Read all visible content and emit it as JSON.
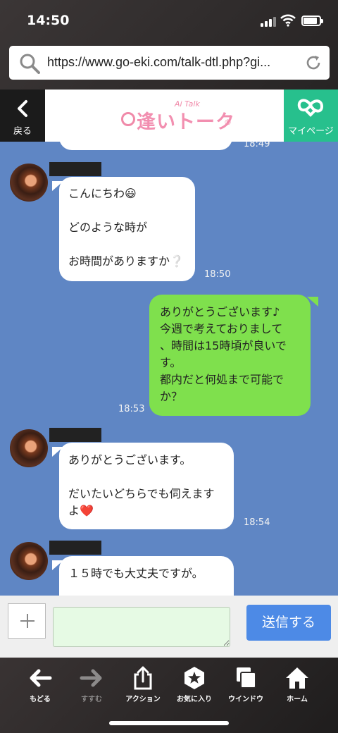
{
  "status_bar": {
    "time": "14:50"
  },
  "browser": {
    "url": "https://www.go-eki.com/talk-dtl.php?gi..."
  },
  "header": {
    "back_label": "戻る",
    "logo_main": "逢いトーク",
    "logo_sub": "Ai Talk",
    "logo_reg": "®",
    "mypage_label": "マイページ"
  },
  "chat": {
    "prev_time": "18:49",
    "messages": [
      {
        "side": "in",
        "lines": [
          "こんにちわ😃",
          "",
          "どのような時が",
          "",
          "お時間がありますか❔"
        ],
        "time": "18:50"
      },
      {
        "side": "out",
        "lines": [
          "ありがとうございます♪",
          "今週で考えておりまして",
          "、時間は15時頃が良いで",
          "す。",
          "都内だと何処まで可能で",
          "か？"
        ],
        "time": "18:53"
      },
      {
        "side": "in",
        "lines": [
          "ありがとうございます。",
          "",
          "だいたいどちらでも伺えます",
          "よ❤️"
        ],
        "time": "18:54"
      },
      {
        "side": "in",
        "lines": [
          "１５時でも大丈夫ですが。"
        ],
        "time": ""
      }
    ]
  },
  "composer": {
    "plus_label": "+",
    "input_value": "",
    "send_label": "送信する"
  },
  "toolbar": {
    "items": [
      {
        "label": "もどる",
        "icon": "arrow-left-icon",
        "enabled": true
      },
      {
        "label": "すすむ",
        "icon": "arrow-right-icon",
        "enabled": false
      },
      {
        "label": "アクション",
        "icon": "share-icon",
        "enabled": true
      },
      {
        "label": "お気に入り",
        "icon": "star-badge-icon",
        "enabled": true
      },
      {
        "label": "ウインドウ",
        "icon": "windows-icon",
        "enabled": true
      },
      {
        "label": "ホーム",
        "icon": "home-icon",
        "enabled": true
      }
    ]
  },
  "colors": {
    "chat_bg": "#5f86c4",
    "outgoing_bubble": "#7fe04d",
    "incoming_bubble": "#ffffff",
    "mypage_green": "#27c08d",
    "send_blue": "#4d8ae6",
    "logo_pink": "#f28fb0"
  }
}
